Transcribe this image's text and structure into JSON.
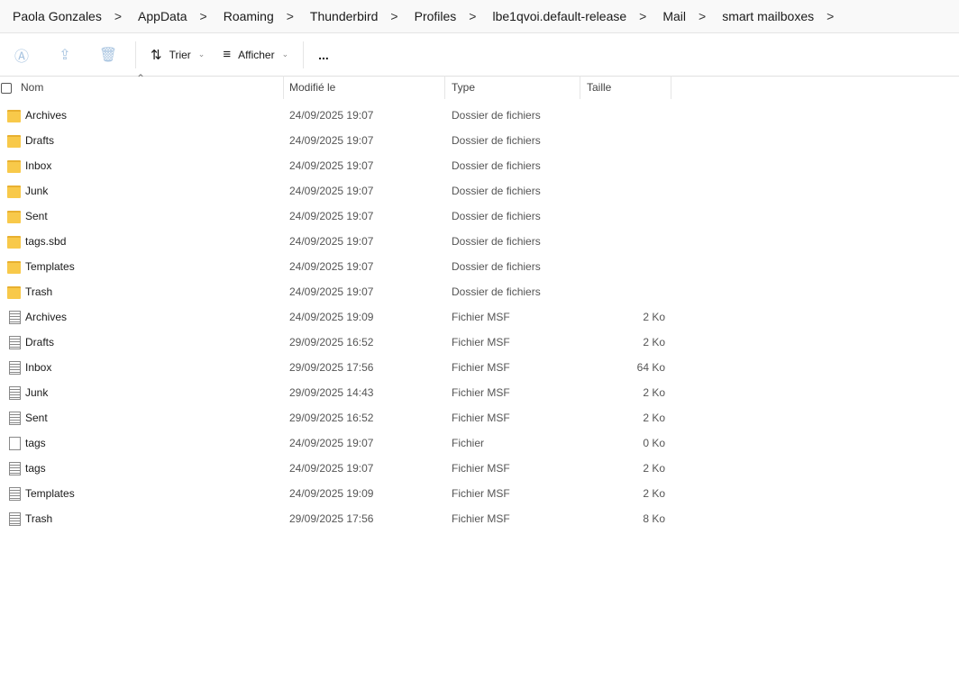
{
  "breadcrumb": [
    "Paola Gonzales",
    "AppData",
    "Roaming",
    "Thunderbird",
    "Profiles",
    "lbe1qvoi.default-release",
    "Mail",
    "smart mailboxes"
  ],
  "toolbar": {
    "sort": "Trier",
    "view": "Afficher",
    "more": "..."
  },
  "columns": {
    "name": "Nom",
    "modified": "Modifié le",
    "type": "Type",
    "size": "Taille"
  },
  "rows": [
    {
      "icon": "folder",
      "name": "Archives",
      "date": "24/09/2025 19:07",
      "type": "Dossier de fichiers",
      "size": ""
    },
    {
      "icon": "folder",
      "name": "Drafts",
      "date": "24/09/2025 19:07",
      "type": "Dossier de fichiers",
      "size": ""
    },
    {
      "icon": "folder",
      "name": "Inbox",
      "date": "24/09/2025 19:07",
      "type": "Dossier de fichiers",
      "size": ""
    },
    {
      "icon": "folder",
      "name": "Junk",
      "date": "24/09/2025 19:07",
      "type": "Dossier de fichiers",
      "size": ""
    },
    {
      "icon": "folder",
      "name": "Sent",
      "date": "24/09/2025 19:07",
      "type": "Dossier de fichiers",
      "size": ""
    },
    {
      "icon": "folder",
      "name": "tags.sbd",
      "date": "24/09/2025 19:07",
      "type": "Dossier de fichiers",
      "size": ""
    },
    {
      "icon": "folder",
      "name": "Templates",
      "date": "24/09/2025 19:07",
      "type": "Dossier de fichiers",
      "size": ""
    },
    {
      "icon": "folder",
      "name": "Trash",
      "date": "24/09/2025 19:07",
      "type": "Dossier de fichiers",
      "size": ""
    },
    {
      "icon": "msf",
      "name": "Archives",
      "date": "24/09/2025 19:09",
      "type": "Fichier MSF",
      "size": "2 Ko"
    },
    {
      "icon": "msf",
      "name": "Drafts",
      "date": "29/09/2025 16:52",
      "type": "Fichier MSF",
      "size": "2 Ko"
    },
    {
      "icon": "msf",
      "name": "Inbox",
      "date": "29/09/2025 17:56",
      "type": "Fichier MSF",
      "size": "64 Ko"
    },
    {
      "icon": "msf",
      "name": "Junk",
      "date": "29/09/2025 14:43",
      "type": "Fichier MSF",
      "size": "2 Ko"
    },
    {
      "icon": "msf",
      "name": "Sent",
      "date": "29/09/2025 16:52",
      "type": "Fichier MSF",
      "size": "2 Ko"
    },
    {
      "icon": "file",
      "name": "tags",
      "date": "24/09/2025 19:07",
      "type": "Fichier",
      "size": "0 Ko"
    },
    {
      "icon": "msf",
      "name": "tags",
      "date": "24/09/2025 19:07",
      "type": "Fichier MSF",
      "size": "2 Ko"
    },
    {
      "icon": "msf",
      "name": "Templates",
      "date": "24/09/2025 19:09",
      "type": "Fichier MSF",
      "size": "2 Ko"
    },
    {
      "icon": "msf",
      "name": "Trash",
      "date": "29/09/2025 17:56",
      "type": "Fichier MSF",
      "size": "8 Ko"
    }
  ]
}
